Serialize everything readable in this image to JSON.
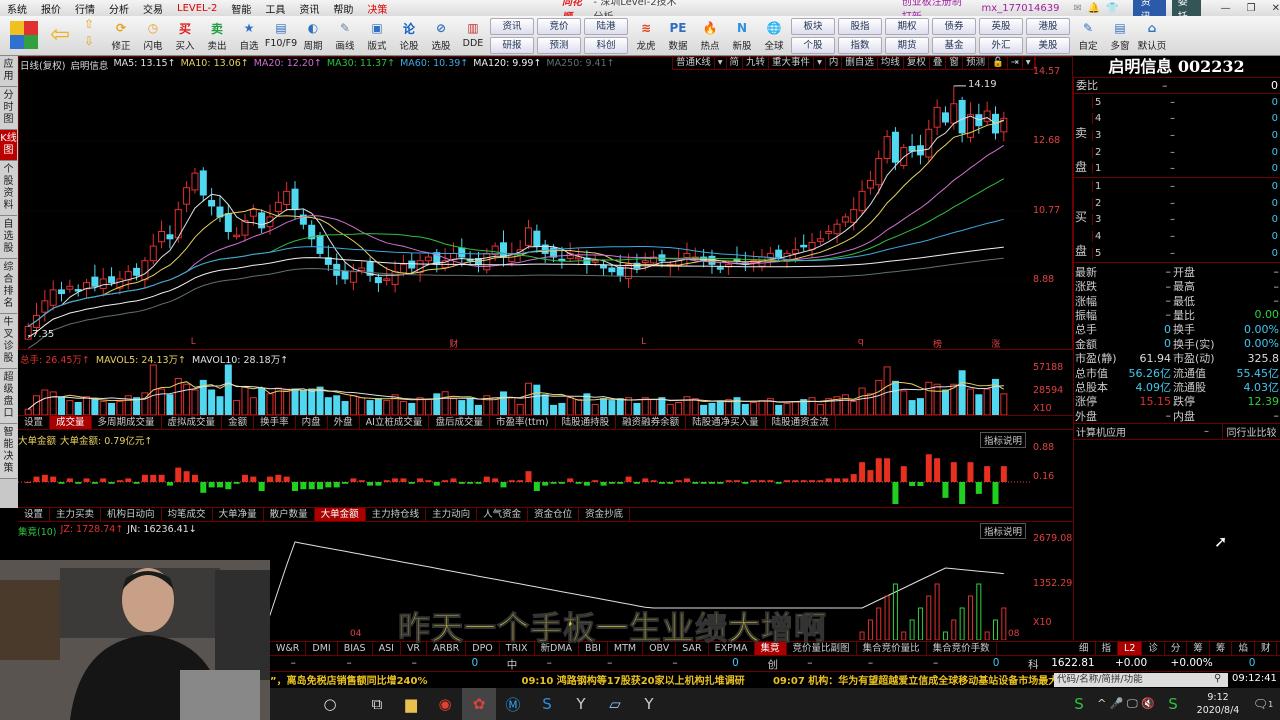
{
  "menu": [
    "系统",
    "报价",
    "行情",
    "分析",
    "交易",
    "LEVEL-2",
    "智能",
    "工具",
    "资讯",
    "帮助",
    "决策"
  ],
  "title": {
    "brand": "同花顺",
    "window": "- 深圳Level-2技术分析",
    "promo": "创业板注册制打新",
    "user": "mx_177014639",
    "news_btn": "资讯",
    "order_btn": "委托"
  },
  "toolbar": {
    "buttons": [
      "修正",
      "闪电",
      "买入",
      "卖出",
      "自选",
      "F10/F9",
      "周期",
      "画线",
      "版式",
      "论股",
      "选股",
      "DDE"
    ],
    "pairs": [
      [
        "资讯",
        "研报"
      ],
      [
        "竞价",
        "预测"
      ],
      [
        "陆港",
        "科创"
      ]
    ],
    "buttons2": [
      "龙虎",
      "数据",
      "热点",
      "新股",
      "全球"
    ],
    "pairs2": [
      [
        "板块",
        "个股"
      ],
      [
        "股指",
        "指数"
      ],
      [
        "期权",
        "期货"
      ],
      [
        "债券",
        "基金"
      ],
      [
        "英股",
        "外汇"
      ],
      [
        "港股",
        "美股"
      ]
    ],
    "buttons3": [
      "自定",
      "多窗",
      "默认页"
    ]
  },
  "left_tabs": [
    "应用",
    "分时图",
    "K线图",
    "个股资料",
    "自选股",
    "综合排名",
    "牛叉诊股",
    "超级盘口",
    "智能决策"
  ],
  "chart_header": {
    "label": "日线(复权)",
    "name": "启明信息",
    "ma": [
      {
        "t": "MA5: 13.15↑",
        "c": "#e0e0e0"
      },
      {
        "t": "MA10: 13.06↑",
        "c": "#e8d060"
      },
      {
        "t": "MA20: 12.20↑",
        "c": "#d070d0"
      },
      {
        "t": "MA30: 11.37↑",
        "c": "#30c040"
      },
      {
        "t": "MA60: 10.39↑",
        "c": "#40a8e0"
      },
      {
        "t": "MA120: 9.99↑",
        "c": "#f0f0f0"
      },
      {
        "t": "MA250: 9.41↑",
        "c": "#607070"
      }
    ]
  },
  "chart_tools": [
    "普通K线",
    "▾",
    "简",
    "九转",
    "重大事件",
    "▾",
    "内",
    "删自选",
    "均线",
    "复权",
    "叠",
    "窗",
    "预测",
    "🔓",
    "⇥",
    "▾"
  ],
  "price_axis": [
    "14.57",
    "12.68",
    "10.77",
    "8.88"
  ],
  "high_label": "14.19",
  "low_label": "7.35",
  "markers": [
    {
      "t": "L",
      "i": 20
    },
    {
      "t": "财",
      "i": 51
    },
    {
      "t": "L",
      "i": 74
    },
    {
      "t": "q",
      "i": 100
    },
    {
      "t": "榜",
      "i": 109
    },
    {
      "t": "涨",
      "i": 116
    }
  ],
  "chart_data": {
    "type": "candlestick",
    "closes": [
      7.6,
      7.9,
      8.3,
      8.6,
      8.5,
      8.7,
      8.6,
      8.8,
      8.7,
      8.9,
      8.8,
      8.9,
      9.1,
      9.0,
      9.4,
      9.8,
      10.2,
      10.0,
      10.8,
      11.4,
      11.8,
      11.2,
      10.9,
      10.6,
      10.2,
      10.1,
      10.5,
      10.8,
      10.3,
      10.6,
      11.0,
      11.3,
      10.8,
      10.4,
      10.0,
      9.6,
      9.3,
      9.0,
      8.9,
      9.1,
      9.2,
      9.0,
      8.8,
      8.9,
      9.1,
      9.3,
      9.2,
      9.4,
      9.5,
      9.3,
      9.4,
      9.6,
      9.5,
      9.4,
      9.3,
      9.6,
      9.8,
      9.5,
      9.6,
      9.7,
      10.3,
      9.8,
      9.6,
      9.5,
      9.4,
      9.6,
      9.5,
      9.3,
      9.4,
      9.2,
      9.1,
      9.0,
      9.3,
      9.2,
      9.4,
      9.5,
      9.4,
      9.3,
      9.4,
      9.6,
      9.5,
      9.4,
      9.3,
      9.2,
      9.3,
      9.4,
      9.3,
      9.4,
      9.5,
      9.6,
      9.5,
      9.6,
      9.7,
      9.8,
      9.9,
      10.0,
      10.2,
      10.4,
      10.6,
      10.8,
      11.3,
      11.6,
      12.2,
      12.8,
      12.1,
      12.5,
      12.4,
      12.3,
      13.0,
      13.6,
      13.2,
      13.7,
      12.9,
      13.4,
      13.1,
      13.5,
      12.9,
      13.3
    ],
    "ylim": [
      7.1,
      14.6
    ]
  },
  "volume": {
    "header": [
      {
        "t": "总手: 26.45万↑",
        "c": "#e03030"
      },
      {
        "t": "MAVOL5: 24.13万↑",
        "c": "#e8d060"
      },
      {
        "t": "MAVOL10: 28.18万↑",
        "c": "#e0e0e0"
      }
    ],
    "axis": [
      "57188",
      "28594",
      "X10"
    ]
  },
  "vol_tabs": [
    "设置",
    "成交量",
    "多周期成交量",
    "虚拟成交量",
    "金额",
    "换手率",
    "内盘",
    "外盘",
    "AI立桩成交量",
    "盘后成交量",
    "市盈率(ttm)",
    "陆股通持股",
    "融资融券余额",
    "陆股通净买入量",
    "陆股通资金流"
  ],
  "ind1": {
    "header": [
      {
        "t": "大单金额",
        "c": "#e8d060"
      },
      {
        "t": "大单金额: 0.79亿元↑",
        "c": "#e8d060"
      }
    ],
    "axis": [
      "0.88",
      "0.16"
    ],
    "explain": "指标说明"
  },
  "ind1_tabs": [
    "设置",
    "主力买卖",
    "机构日动向",
    "均笔成交",
    "大单净量",
    "散户数量",
    "大单金额",
    "主力持仓线",
    "主力动向",
    "人气资金",
    "资金仓位",
    "资金抄底"
  ],
  "ind2": {
    "header": [
      {
        "t": "集竟(10)",
        "c": "#30c040"
      },
      {
        "t": "JZ: 1728.74↑",
        "c": "#e03030"
      },
      {
        "t": "JN: 16236.41↓",
        "c": "#e0e0e0"
      }
    ],
    "axis": [
      "2679.08",
      "1352.29",
      "X10"
    ],
    "explain": "指标说明",
    "dates": [
      "04",
      "08"
    ]
  },
  "ind2_tabs": [
    "W&R",
    "DMI",
    "BIAS",
    "ASI",
    "VR",
    "ARBR",
    "DPO",
    "TRIX",
    "新DMA",
    "BBI",
    "MTM",
    "OBV",
    "SAR",
    "EXPMA",
    "集竟",
    "竞价量比副图",
    "集合竞价量比",
    "集合竞价手数"
  ],
  "status_row": [
    {
      "t": "–"
    },
    {
      "t": "–"
    },
    {
      "t": "–"
    },
    {
      "t": "0",
      "c": "#40c8f0"
    },
    {
      "t": "中"
    },
    {
      "t": "–"
    },
    {
      "t": "–"
    },
    {
      "t": "–"
    },
    {
      "t": "0",
      "c": "#40c8f0"
    },
    {
      "t": "创"
    },
    {
      "t": "–"
    },
    {
      "t": "–"
    },
    {
      "t": "–"
    },
    {
      "t": "0",
      "c": "#40c8f0"
    },
    {
      "t": "科"
    },
    {
      "t": "1622.81",
      "c": "#fff"
    },
    {
      "t": "+0.00",
      "c": "#fff"
    },
    {
      "t": "+0.00%",
      "c": "#fff"
    },
    {
      "t": "0",
      "c": "#40c8f0"
    }
  ],
  "ticker": [
    "”，离岛免税店销售额同比增240%",
    "09:10 鸿路钢构等17股获20家以上机构扎堆调研",
    "09:07 机构：华为有望超越爱立信成全球移动基站设备市场最大"
  ],
  "search": {
    "placeholder": "代码/名称/简拼/功能",
    "time": "09:12:41"
  },
  "right": {
    "stock": "启明信息 002232",
    "weibi": {
      "label": "委比",
      "mid": "–",
      "val": "0"
    },
    "sell_label": [
      "卖",
      "盘"
    ],
    "buy_label": [
      "买",
      "盘"
    ],
    "sell": [
      {
        "n": "5",
        "p": "–",
        "v": "0"
      },
      {
        "n": "4",
        "p": "–",
        "v": "0"
      },
      {
        "n": "3",
        "p": "–",
        "v": "0"
      },
      {
        "n": "2",
        "p": "–",
        "v": "0"
      },
      {
        "n": "1",
        "p": "–",
        "v": "0"
      }
    ],
    "buy": [
      {
        "n": "1",
        "p": "–",
        "v": "0"
      },
      {
        "n": "2",
        "p": "–",
        "v": "0"
      },
      {
        "n": "3",
        "p": "–",
        "v": "0"
      },
      {
        "n": "4",
        "p": "–",
        "v": "0"
      },
      {
        "n": "5",
        "p": "–",
        "v": "0"
      }
    ],
    "quote": [
      [
        "最新",
        "–",
        "开盘",
        "–"
      ],
      [
        "涨跌",
        "–",
        "最高",
        "–"
      ],
      [
        "涨幅",
        "–",
        "最低",
        "–"
      ],
      [
        "振幅",
        "–",
        "量比",
        "0.00"
      ],
      [
        "总手",
        "0",
        "换手",
        "0.00%"
      ],
      [
        "金额",
        "0",
        "换手(实)",
        "0.00%"
      ],
      [
        "市盈(静)",
        "61.94",
        "市盈(动)",
        "325.8"
      ],
      [
        "总市值",
        "56.26亿",
        "流通值",
        "55.45亿"
      ],
      [
        "总股本",
        "4.09亿",
        "流通股",
        "4.03亿"
      ],
      [
        "涨停",
        "15.15",
        "跌停",
        "12.39"
      ],
      [
        "外盘",
        "–",
        "内盘",
        "–"
      ]
    ],
    "quote_colors": [
      [
        "#ccc",
        "#ccc"
      ],
      [
        "#ccc",
        "#ccc"
      ],
      [
        "#ccc",
        "#ccc"
      ],
      [
        "#ccc",
        "#30d040"
      ],
      [
        "#40c8f0",
        "#40c8f0"
      ],
      [
        "#40c8f0",
        "#40c8f0"
      ],
      [
        "#ddd",
        "#ddd"
      ],
      [
        "#40c8f0",
        "#40c8f0"
      ],
      [
        "#40c8f0",
        "#40c8f0"
      ],
      [
        "#e03030",
        "#30d040"
      ],
      [
        "#ccc",
        "#ccc"
      ]
    ],
    "industry": "计算机应用",
    "industry_dash": "–",
    "compare": "同行业比较",
    "tabs": [
      "细",
      "指",
      "L2",
      "诊",
      "分",
      "筹",
      "筹",
      "焰",
      "财"
    ]
  },
  "subtitle": "昨天一个手板一生业绩大增啊",
  "taskbar": {
    "time": "9:12",
    "date": "2020/8/4",
    "notif": "1"
  },
  "colors": {
    "up": "#e03030",
    "down": "#50d8f0",
    "grid": "#6b0000"
  }
}
